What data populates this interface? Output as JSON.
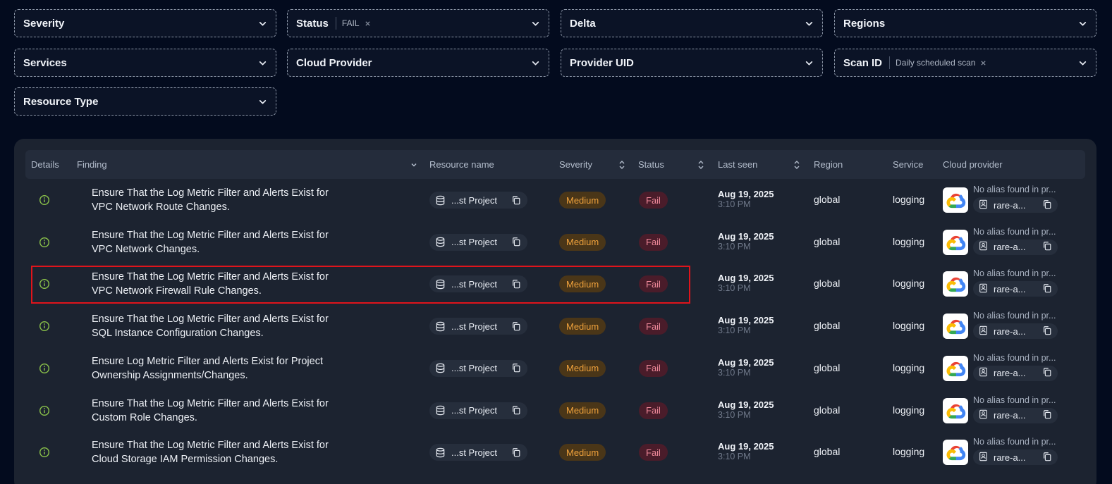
{
  "filters": [
    {
      "label": "Severity",
      "chip": ""
    },
    {
      "label": "Status",
      "chip": "FAIL"
    },
    {
      "label": "Delta",
      "chip": ""
    },
    {
      "label": "Regions",
      "chip": ""
    },
    {
      "label": "Services",
      "chip": ""
    },
    {
      "label": "Cloud Provider",
      "chip": ""
    },
    {
      "label": "Provider UID",
      "chip": ""
    },
    {
      "label": "Scan ID",
      "chip": "Daily scheduled scan"
    },
    {
      "label": "Resource Type",
      "chip": ""
    }
  ],
  "table": {
    "headers": {
      "details": "Details",
      "finding": "Finding",
      "resource": "Resource name",
      "severity": "Severity",
      "status": "Status",
      "last_seen": "Last seen",
      "region": "Region",
      "service": "Service",
      "provider": "Cloud provider"
    },
    "rows": [
      {
        "finding_line1": "Ensure That the Log Metric Filter and Alerts Exist for",
        "finding_line2": "VPC Network Route Changes.",
        "resource": "...st Project",
        "severity": "Medium",
        "status": "Fail",
        "date": "Aug 19, 2025",
        "time": "3:10 PM",
        "region": "global",
        "service": "logging",
        "alias": "No alias found in pr...",
        "uid": "rare-a..."
      },
      {
        "finding_line1": "Ensure That the Log Metric Filter and Alerts Exist for",
        "finding_line2": "VPC Network Changes.",
        "resource": "...st Project",
        "severity": "Medium",
        "status": "Fail",
        "date": "Aug 19, 2025",
        "time": "3:10 PM",
        "region": "global",
        "service": "logging",
        "alias": "No alias found in pr...",
        "uid": "rare-a..."
      },
      {
        "finding_line1": "Ensure That the Log Metric Filter and Alerts Exist for",
        "finding_line2": "VPC Network Firewall Rule Changes.",
        "resource": "...st Project",
        "severity": "Medium",
        "status": "Fail",
        "date": "Aug 19, 2025",
        "time": "3:10 PM",
        "region": "global",
        "service": "logging",
        "alias": "No alias found in pr...",
        "uid": "rare-a..."
      },
      {
        "finding_line1": "Ensure That the Log Metric Filter and Alerts Exist for",
        "finding_line2": "SQL Instance Configuration Changes.",
        "resource": "...st Project",
        "severity": "Medium",
        "status": "Fail",
        "date": "Aug 19, 2025",
        "time": "3:10 PM",
        "region": "global",
        "service": "logging",
        "alias": "No alias found in pr...",
        "uid": "rare-a..."
      },
      {
        "finding_line1": "Ensure Log Metric Filter and Alerts Exist for Project",
        "finding_line2": "Ownership Assignments/Changes.",
        "resource": "...st Project",
        "severity": "Medium",
        "status": "Fail",
        "date": "Aug 19, 2025",
        "time": "3:10 PM",
        "region": "global",
        "service": "logging",
        "alias": "No alias found in pr...",
        "uid": "rare-a..."
      },
      {
        "finding_line1": "Ensure That the Log Metric Filter and Alerts Exist for",
        "finding_line2": "Custom Role Changes.",
        "resource": "...st Project",
        "severity": "Medium",
        "status": "Fail",
        "date": "Aug 19, 2025",
        "time": "3:10 PM",
        "region": "global",
        "service": "logging",
        "alias": "No alias found in pr...",
        "uid": "rare-a..."
      },
      {
        "finding_line1": "Ensure That the Log Metric Filter and Alerts Exist for",
        "finding_line2": "Cloud Storage IAM Permission Changes.",
        "resource": "...st Project",
        "severity": "Medium",
        "status": "Fail",
        "date": "Aug 19, 2025",
        "time": "3:10 PM",
        "region": "global",
        "service": "logging",
        "alias": "No alias found in pr...",
        "uid": "rare-a..."
      }
    ]
  },
  "colors": {
    "background": "#030b1e",
    "panel": "#1c2330",
    "medium_badge": "#f0a23c",
    "fail_badge": "#f08a9b",
    "info_icon": "#8bc34a",
    "highlight_box": "#e0141b"
  },
  "icons": {
    "filter_chevron": "chevron-down-icon",
    "chip_remove": "close-icon",
    "details": "info-circle-icon",
    "resource": "database-icon",
    "copy": "copy-icon",
    "sort": "sort-arrows-icon",
    "provider": "google-cloud-logo",
    "uid": "id-card-icon"
  }
}
